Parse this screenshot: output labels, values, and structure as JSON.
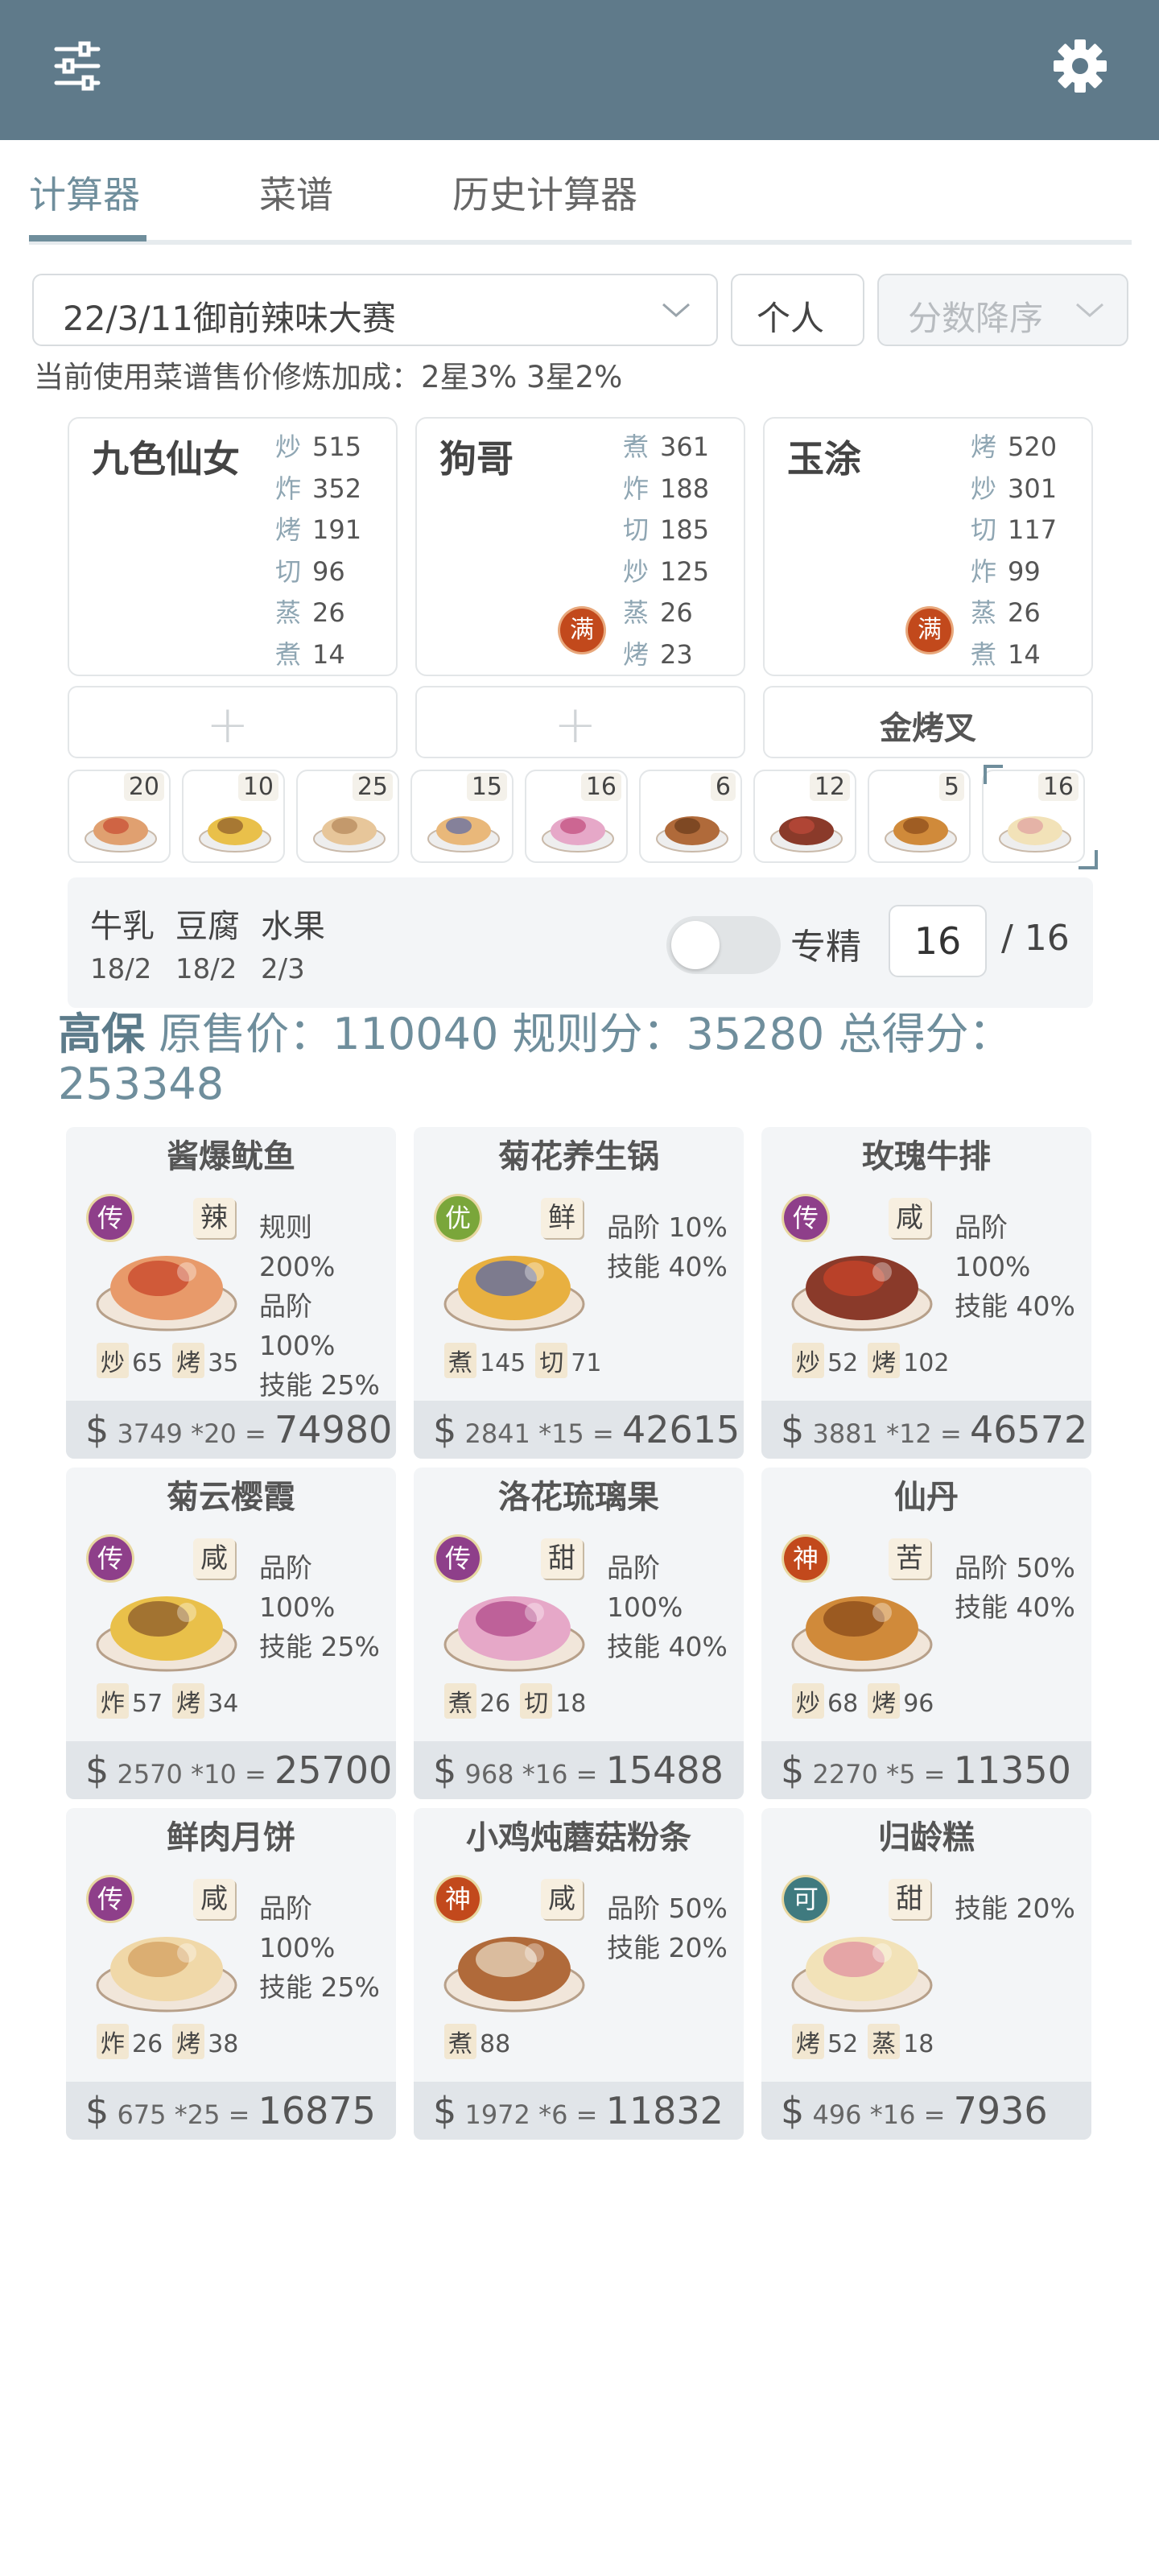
{
  "header": {
    "menu_icon": "sliders-icon",
    "settings_icon": "gear-icon",
    "color": "#5f7a8a"
  },
  "tabs": [
    {
      "label": "计算器",
      "active": true
    },
    {
      "label": "菜谱",
      "active": false
    },
    {
      "label": "历史计算器",
      "active": false
    }
  ],
  "controls": {
    "contest": "22/3/11御前辣味大赛",
    "mode": "个人",
    "sort": "分数降序"
  },
  "bonus_text": "当前使用菜谱售价修炼加成：2星3% 3星2%",
  "chefs": [
    {
      "name": "九色仙女",
      "skills": [
        [
          "炒",
          "515"
        ],
        [
          "炸",
          "352"
        ],
        [
          "烤",
          "191"
        ],
        [
          "切",
          "96"
        ],
        [
          "蒸",
          "26"
        ],
        [
          "煮",
          "14"
        ]
      ],
      "badge": ""
    },
    {
      "name": "狗哥",
      "skills": [
        [
          "煮",
          "361"
        ],
        [
          "炸",
          "188"
        ],
        [
          "切",
          "185"
        ],
        [
          "炒",
          "125"
        ],
        [
          "蒸",
          "26"
        ],
        [
          "烤",
          "23"
        ]
      ],
      "badge": "满"
    },
    {
      "name": "玉涂",
      "skills": [
        [
          "烤",
          "520"
        ],
        [
          "炒",
          "301"
        ],
        [
          "切",
          "117"
        ],
        [
          "炸",
          "99"
        ],
        [
          "蒸",
          "26"
        ],
        [
          "煮",
          "14"
        ]
      ],
      "badge": "满"
    }
  ],
  "equips": [
    {
      "label": ""
    },
    {
      "label": ""
    },
    {
      "label": "金烤叉"
    }
  ],
  "dish_counts": [
    "20",
    "10",
    "25",
    "15",
    "16",
    "6",
    "12",
    "5",
    "16"
  ],
  "materials": [
    {
      "name": "牛乳",
      "value": "18/2"
    },
    {
      "name": "豆腐",
      "value": "18/2"
    },
    {
      "name": "水果",
      "value": "2/3"
    }
  ],
  "focus": {
    "label": "专精",
    "value": "16",
    "total": "/ 16",
    "enabled": false
  },
  "summary": {
    "rank": "高保",
    "orig_label": "原售价：",
    "orig": "110040",
    "rule_label": "规则分：",
    "rule": "35280",
    "total_label": "总得分：",
    "total": "253348"
  },
  "recipes": [
    {
      "name": "酱爆鱿鱼",
      "rarity": "传",
      "rarity_color": "#8e3f8a",
      "flavor": "辣",
      "bonus": [
        "规则 200%",
        "品阶 100%",
        "技能 25%"
      ],
      "skills": [
        [
          "炒",
          "65"
        ],
        [
          "烤",
          "35"
        ]
      ],
      "price": "3749",
      "qty": "*20",
      "total": "74980"
    },
    {
      "name": "菊花养生锅",
      "rarity": "优",
      "rarity_color": "#7aa63a",
      "flavor": "鲜",
      "bonus": [
        "品阶 10%",
        "技能 40%"
      ],
      "skills": [
        [
          "煮",
          "145"
        ],
        [
          "切",
          "71"
        ]
      ],
      "price": "2841",
      "qty": "*15",
      "total": "42615"
    },
    {
      "name": "玫瑰牛排",
      "rarity": "传",
      "rarity_color": "#8e3f8a",
      "flavor": "咸",
      "bonus": [
        "品阶 100%",
        "技能 40%"
      ],
      "skills": [
        [
          "炒",
          "52"
        ],
        [
          "烤",
          "102"
        ]
      ],
      "price": "3881",
      "qty": "*12",
      "total": "46572"
    },
    {
      "name": "菊云樱霞",
      "rarity": "传",
      "rarity_color": "#8e3f8a",
      "flavor": "咸",
      "bonus": [
        "品阶 100%",
        "技能 25%"
      ],
      "skills": [
        [
          "炸",
          "57"
        ],
        [
          "烤",
          "34"
        ]
      ],
      "price": "2570",
      "qty": "*10",
      "total": "25700"
    },
    {
      "name": "洛花琉璃果",
      "rarity": "传",
      "rarity_color": "#8e3f8a",
      "flavor": "甜",
      "bonus": [
        "品阶 100%",
        "技能 40%"
      ],
      "skills": [
        [
          "煮",
          "26"
        ],
        [
          "切",
          "18"
        ]
      ],
      "price": "968",
      "qty": "*16",
      "total": "15488"
    },
    {
      "name": "仙丹",
      "rarity": "神",
      "rarity_color": "#c2491c",
      "flavor": "苦",
      "bonus": [
        "品阶 50%",
        "技能 40%"
      ],
      "skills": [
        [
          "炒",
          "68"
        ],
        [
          "烤",
          "96"
        ]
      ],
      "price": "2270",
      "qty": "*5",
      "total": "11350"
    },
    {
      "name": "鲜肉月饼",
      "rarity": "传",
      "rarity_color": "#8e3f8a",
      "flavor": "咸",
      "bonus": [
        "品阶 100%",
        "技能 25%"
      ],
      "skills": [
        [
          "炸",
          "26"
        ],
        [
          "烤",
          "38"
        ]
      ],
      "price": "675",
      "qty": "*25",
      "total": "16875"
    },
    {
      "name": "小鸡炖蘑菇粉条",
      "rarity": "神",
      "rarity_color": "#c2491c",
      "flavor": "咸",
      "bonus": [
        "品阶 50%",
        "技能 20%"
      ],
      "skills": [
        [
          "煮",
          "88"
        ]
      ],
      "price": "1972",
      "qty": "*6",
      "total": "11832"
    },
    {
      "name": "归龄糕",
      "rarity": "可",
      "rarity_color": "#3f7a7f",
      "flavor": "甜",
      "bonus": [
        "技能 20%"
      ],
      "skills": [
        [
          "烤",
          "52"
        ],
        [
          "蒸",
          "18"
        ]
      ],
      "price": "496",
      "qty": "*16",
      "total": "7936"
    }
  ]
}
